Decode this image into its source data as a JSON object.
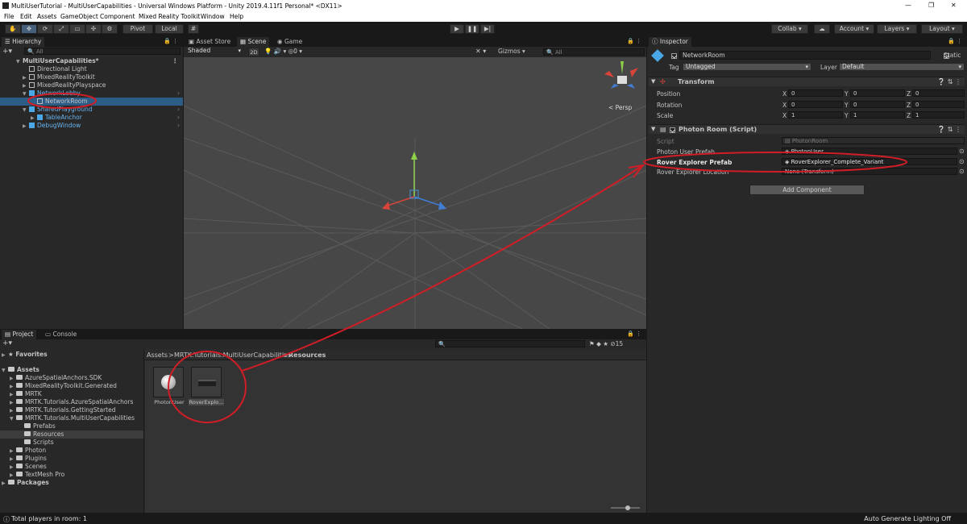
{
  "window": {
    "title": "MultiUserTutorial - MultiUserCapabilities - Universal Windows Platform - Unity 2019.4.11f1 Personal* <DX11>",
    "minimize": "—",
    "maximize": "❐",
    "close": "✕"
  },
  "menu": [
    "File",
    "Edit",
    "Assets",
    "GameObject",
    "Component",
    "Mixed Reality Toolkit",
    "Window",
    "Help"
  ],
  "toolbar": {
    "pivot": "Pivot",
    "local": "Local",
    "collab": "Collab",
    "account": "Account",
    "layers": "Layers",
    "layout": "Layout"
  },
  "hierarchy": {
    "tab": "Hierarchy",
    "search": "All",
    "scene": "MultiUserCapabilities*",
    "items": [
      {
        "label": "Directional Light"
      },
      {
        "label": "MixedRealityToolkit"
      },
      {
        "label": "MixedRealityPlayspace"
      },
      {
        "label": "NetworkLobby"
      },
      {
        "label": "NetworkRoom"
      },
      {
        "label": "SharedPlayground"
      },
      {
        "label": "TableAnchor"
      },
      {
        "label": "DebugWindow"
      }
    ]
  },
  "scene": {
    "tabs": [
      "Asset Store",
      "Scene",
      "Game"
    ],
    "shading": "Shaded",
    "mode2d": "2D",
    "gizmos": "Gizmos",
    "search": "All",
    "persp": "< Persp",
    "fx_count": "0"
  },
  "inspector": {
    "tab": "Inspector",
    "object_name": "NetworkRoom",
    "static": "Static",
    "tag_label": "Tag",
    "tag": "Untagged",
    "layer_label": "Layer",
    "layer": "Default",
    "transform": {
      "title": "Transform",
      "position": "Position",
      "rotation": "Rotation",
      "scale": "Scale",
      "x": "X",
      "y": "Y",
      "z": "Z",
      "pos": [
        "0",
        "0",
        "0"
      ],
      "rot": [
        "0",
        "0",
        "0"
      ],
      "scl": [
        "1",
        "1",
        "1"
      ]
    },
    "photon": {
      "title": "Photon Room (Script)",
      "script_label": "Script",
      "script": "PhotonRoom",
      "f1_label": "Photon User Prefab",
      "f1": "PhotonUser",
      "f2_label": "Rover Explorer Prefab",
      "f2": "RoverExplorer_Complete_Variant",
      "f3_label": "Rover Explorer Location",
      "f3": "None (Transform)"
    },
    "add_component": "Add Component"
  },
  "project": {
    "tabs": [
      "Project",
      "Console"
    ],
    "favorites": "Favorites",
    "assets": "Assets",
    "count": "15",
    "tree": [
      "AzureSpatialAnchors.SDK",
      "MixedRealityToolkit.Generated",
      "MRTK",
      "MRTK.Tutorials.AzureSpatialAnchors",
      "MRTK.Tutorials.GettingStarted",
      "MRTK.Tutorials.MultiUserCapabilities",
      "Prefabs",
      "Resources",
      "Scripts",
      "Photon",
      "Plugins",
      "Scenes",
      "TextMesh Pro"
    ],
    "packages": "Packages",
    "breadcrumb": [
      "Assets",
      "MRTK.Tutorials.MultiUserCapabilities",
      "Resources"
    ],
    "files": [
      "PhotonUser",
      "RoverExplo..."
    ]
  },
  "status": {
    "left": "Total players in room: 1",
    "right": "Auto Generate Lighting Off"
  }
}
